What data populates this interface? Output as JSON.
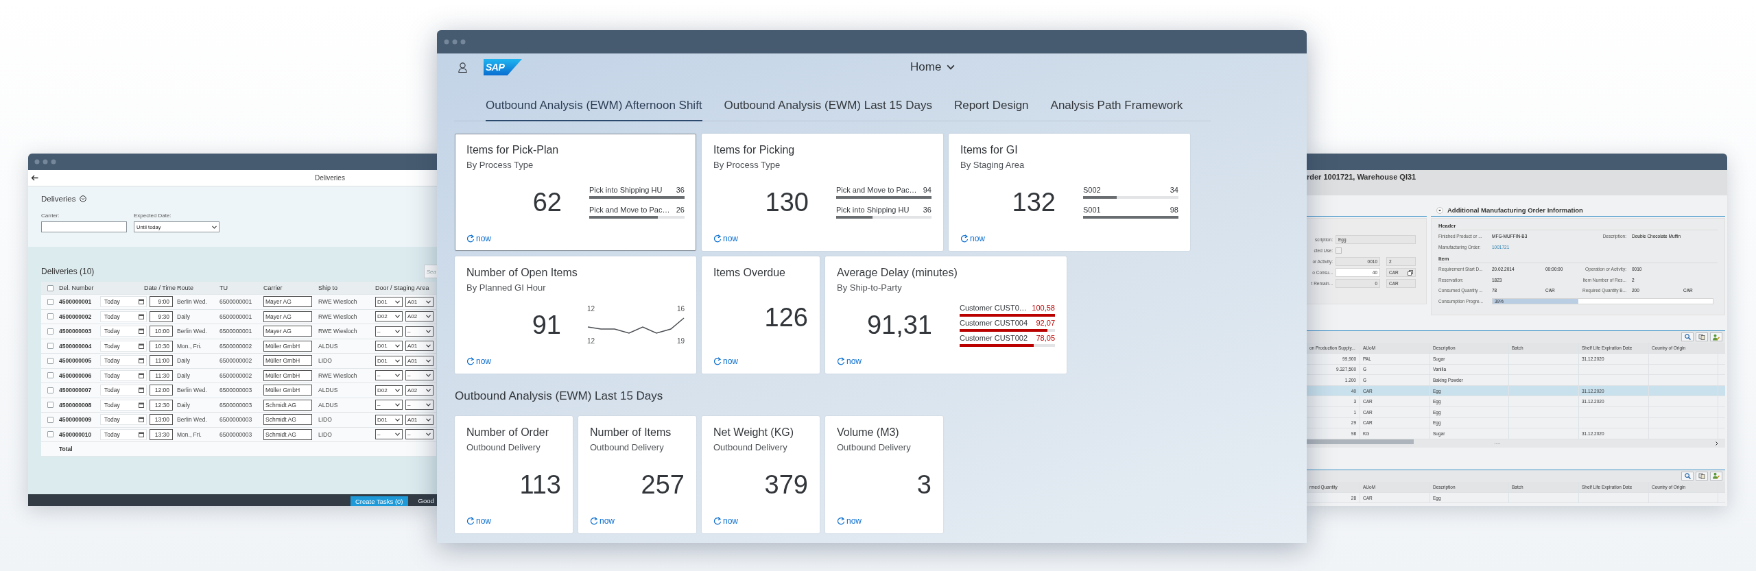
{
  "deliveries_window": {
    "nav_title": "Deliveries",
    "header_title": "Deliveries",
    "filters": [
      {
        "label": "Carrier:",
        "kind": "input"
      },
      {
        "label": "Expected Date:",
        "kind": "select",
        "value": "Until today"
      }
    ],
    "table_title": "Deliveries (10)",
    "search_placeholder": "Sea",
    "all_checked": false,
    "columns": [
      "Del. Number",
      "Date / Time",
      "Route",
      "TU",
      "Carrier",
      "Ship to",
      "Door / Staging Area"
    ],
    "rows": [
      {
        "checked": false,
        "number": "4500000001",
        "date": "Today",
        "time": "9:00",
        "route": "Berlin Wed.",
        "tu": "6500000001",
        "carrier": "Mayer AG",
        "ship_to": "RWE Wiesloch",
        "door": "D01",
        "area": "A01"
      },
      {
        "checked": false,
        "number": "4500000002",
        "date": "Today",
        "time": "9:30",
        "route": "Daily",
        "tu": "6500000001",
        "carrier": "Mayer AG",
        "ship_to": "RWE Wiesloch",
        "door": "D02",
        "area": "A02"
      },
      {
        "checked": false,
        "number": "4500000003",
        "date": "Today",
        "time": "10:00",
        "route": "Berlin Wed.",
        "tu": "6500000001",
        "carrier": "Mayer AG",
        "ship_to": "RWE Wiesloch",
        "door": "–",
        "area": "–"
      },
      {
        "checked": false,
        "number": "4500000004",
        "date": "Today",
        "time": "10:30",
        "route": "Mon., Fri.",
        "tu": "6500000002",
        "carrier": "Müller GmbH",
        "ship_to": "ALDUS",
        "door": "D01",
        "area": "A01"
      },
      {
        "checked": false,
        "number": "4500000005",
        "date": "Today",
        "time": "11:00",
        "route": "Daily",
        "tu": "6500000002",
        "carrier": "Müller GmbH",
        "ship_to": "LIDO",
        "door": "D01",
        "area": "A01"
      },
      {
        "checked": false,
        "number": "4500000006",
        "date": "Today",
        "time": "11:30",
        "route": "Daily",
        "tu": "6500000002",
        "carrier": "Müller GmbH",
        "ship_to": "RWE Wiesloch",
        "door": "–",
        "area": "–"
      },
      {
        "checked": false,
        "number": "4500000007",
        "date": "Today",
        "time": "12:00",
        "route": "Berlin Wed.",
        "tu": "6500000003",
        "carrier": "Müller GmbH",
        "ship_to": "ALDUS",
        "door": "D02",
        "area": "A02"
      },
      {
        "checked": false,
        "number": "4500000008",
        "date": "Today",
        "time": "12:30",
        "route": "Daily",
        "tu": "6500000003",
        "carrier": "Schmidt AG",
        "ship_to": "ALDUS",
        "door": "–",
        "area": "–"
      },
      {
        "checked": false,
        "number": "4500000009",
        "date": "Today",
        "time": "13:00",
        "route": "Berlin Wed.",
        "tu": "6500000003",
        "carrier": "Schmidt AG",
        "ship_to": "LIDO",
        "door": "D01",
        "area": "A01"
      },
      {
        "checked": false,
        "number": "4500000010",
        "date": "Today",
        "time": "13:30",
        "route": "Mon., Fri.",
        "tu": "6500000003",
        "carrier": "Schmidt AG",
        "ship_to": "LIDO",
        "door": "–",
        "area": "–"
      }
    ],
    "total_label": "Total",
    "buttons": [
      {
        "label": "Create Tasks (0)",
        "kind": "primary"
      },
      {
        "label": "Good",
        "kind": "plain"
      }
    ]
  },
  "launchpad_window": {
    "logo_text": "SAP",
    "home_menu": "Home",
    "tabs": [
      {
        "label": "Outbound Analysis (EWM) Afternoon Shift",
        "selected": true
      },
      {
        "label": "Outbound Analysis (EWM) Last 15 Days",
        "selected": false
      },
      {
        "label": "Report Design",
        "selected": false
      },
      {
        "label": "Analysis Path Framework",
        "selected": false
      }
    ],
    "groups": [
      {
        "tiles": [
          {
            "kind": "comparison",
            "wide": true,
            "focused": true,
            "critical": false,
            "title": "Items for Pick-Plan",
            "subtitle": "By Process Type",
            "value": "62",
            "footer": "now",
            "bars": [
              {
                "label": "Pick into Shipping HU",
                "value": "36",
                "level": 1
              },
              {
                "label": "Pick and Move to Pac…",
                "value": "26",
                "level": 0.72
              }
            ]
          },
          {
            "kind": "comparison",
            "wide": true,
            "focused": false,
            "critical": false,
            "title": "Items for Picking",
            "subtitle": "By Process Type",
            "value": "130",
            "footer": "now",
            "bars": [
              {
                "label": "Pick and Move to Pac…",
                "value": "94",
                "level": 1
              },
              {
                "label": "Pick into Shipping HU",
                "value": "36",
                "level": 0.38
              }
            ]
          },
          {
            "kind": "comparison",
            "wide": true,
            "focused": false,
            "critical": false,
            "title": "Items for GI",
            "subtitle": "By Staging Area",
            "value": "132",
            "footer": "now",
            "bars": [
              {
                "label": "S002",
                "value": "34",
                "level": 0.35
              },
              {
                "label": "S001",
                "value": "98",
                "level": 1
              }
            ]
          },
          {
            "kind": "line",
            "wide": true,
            "focused": false,
            "title": "Number of Open Items",
            "subtitle": "By Planned GI Hour",
            "value": "91",
            "footer": "now",
            "top_start": "12",
            "top_end": "16",
            "bottom_start": "12",
            "bottom_end": "19"
          },
          {
            "kind": "numeric",
            "wide": false,
            "focused": false,
            "title": "Items Overdue",
            "value": "126",
            "footer": "now"
          },
          {
            "kind": "comparison",
            "wide": true,
            "focused": false,
            "critical": true,
            "title": "Average Delay (minutes)",
            "subtitle": "By Ship-to-Party",
            "value": "91,31",
            "footer": "now",
            "bars": [
              {
                "label": "Customer CUST0…",
                "value": "100,58",
                "level": 1
              },
              {
                "label": "Customer CUST004",
                "value": "92,07",
                "level": 0.92
              },
              {
                "label": "Customer CUST002",
                "value": "78,05",
                "level": 0.78
              }
            ]
          }
        ]
      },
      {
        "title": "Outbound Analysis (EWM) Last 15 Days",
        "tiles": [
          {
            "kind": "numeric",
            "wide": false,
            "focused": false,
            "title": "Number of Order",
            "subtitle": "Outbound Delivery",
            "value": "113",
            "footer": "now"
          },
          {
            "kind": "numeric",
            "wide": false,
            "focused": false,
            "title": "Number of Items",
            "subtitle": "Outbound Delivery",
            "value": "257",
            "footer": "now"
          },
          {
            "kind": "numeric",
            "wide": false,
            "focused": false,
            "title": "Net Weight (KG)",
            "subtitle": "Outbound Delivery",
            "value": "379",
            "footer": "now"
          },
          {
            "kind": "numeric",
            "wide": false,
            "focused": false,
            "title": "Volume (M3)",
            "subtitle": "Outbound Delivery",
            "value": "3",
            "footer": "now"
          }
        ]
      }
    ]
  },
  "order_window": {
    "title": "rder 1001721, Warehouse QI31",
    "form": [
      {
        "label": "scription:",
        "kind": "text",
        "value": "Egg"
      },
      {
        "label": "cted Use:",
        "kind": "checkbox",
        "checked": false
      },
      {
        "label": "or Activity:",
        "kind": "pair",
        "value": "0010",
        "unit": "2",
        "editable": false
      },
      {
        "label": "o Consu...",
        "kind": "pair",
        "value": "40",
        "unit": "CAR",
        "editable": true
      },
      {
        "label": "t Remain...",
        "kind": "pair",
        "value": "0",
        "unit": "CAR",
        "editable": false
      }
    ],
    "info_panel": {
      "title": "Additional Manufacturing Order Information",
      "expanded": true,
      "sections": [
        {
          "heading": "Header",
          "rows": [
            {
              "kind": "fields",
              "label": "Finished Product or ...",
              "value": "MFG-MUFFIN-B3",
              "label2": "Description:",
              "value2": "Double Chocolate Muffin"
            },
            {
              "kind": "fields",
              "label": "Manufacturing Order:",
              "link": "1001721"
            }
          ]
        },
        {
          "heading": "Item",
          "rows": [
            {
              "kind": "fields",
              "label": "Requirement Start D...",
              "value": "20.02.2014",
              "extra": "00:00:00",
              "label2": "Operation or Activity:",
              "value2": "0010"
            },
            {
              "kind": "fields",
              "label": "Reservation:",
              "value": "1823",
              "label2": "Item Number of Res...",
              "value2": "2"
            },
            {
              "kind": "fields",
              "label": "Consumed Quantity ...",
              "value": "78",
              "extra": "CAR",
              "label2": "Required Quantity B...",
              "value2": "200",
              "unit2": "CAR"
            },
            {
              "kind": "progress",
              "label": "Consumption Progre...",
              "level": 0.39,
              "text": "39%"
            }
          ]
        }
      ]
    },
    "tables": [
      {
        "columns": [
          "on Production Supply...",
          "AUoM",
          "Description",
          "Batch",
          "Shelf Life Expiration Date",
          "Country of Origin"
        ],
        "rows": [
          {
            "selected": false,
            "quantity": "99,900",
            "uom": "PAL",
            "description": "Sugar",
            "expiry": "31.12.2020"
          },
          {
            "selected": false,
            "quantity": "9.327,500",
            "uom": "G",
            "description": "Vanilla"
          },
          {
            "selected": false,
            "quantity": "1.200",
            "uom": "G",
            "description": "Baking Powder"
          },
          {
            "selected": true,
            "quantity": "40",
            "uom": "CAR",
            "description": "Egg",
            "expiry": "31.12.2020"
          },
          {
            "selected": false,
            "quantity": "3",
            "uom": "CAR",
            "description": "Egg",
            "expiry": "31.12.2020"
          },
          {
            "selected": false,
            "quantity": "1",
            "uom": "CAR",
            "description": "Egg"
          },
          {
            "selected": false,
            "quantity": "29",
            "uom": "CAR",
            "description": "Egg"
          },
          {
            "selected": false,
            "quantity": "98",
            "uom": "KG",
            "description": "Sugar",
            "expiry": "31.12.2020"
          }
        ]
      },
      {
        "columns": [
          "rmed Quantity",
          "AUoM",
          "Description",
          "Batch",
          "Shelf Life Expiration Date",
          "Country of Origin"
        ],
        "rows": [
          {
            "selected": false,
            "quantity": "28",
            "uom": "CAR",
            "description": "Egg"
          }
        ]
      }
    ]
  }
}
